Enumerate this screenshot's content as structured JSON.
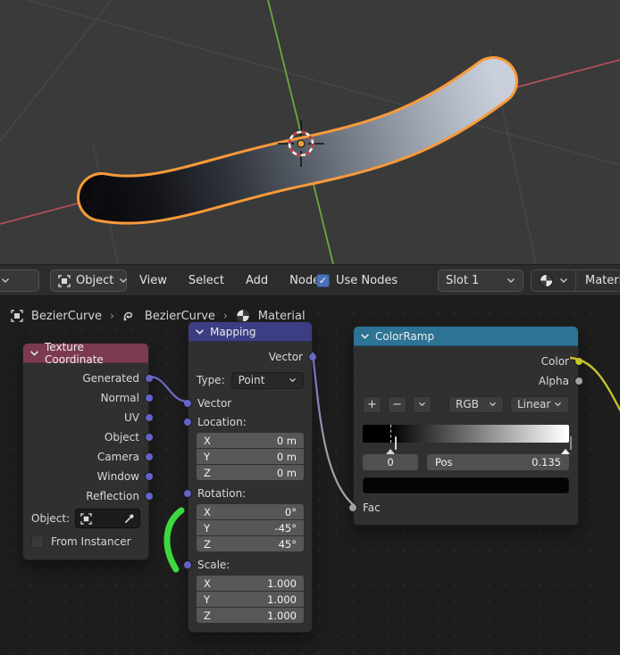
{
  "header": {
    "editor_type_dropdown": {
      "icon": "shader-editor-icon"
    },
    "mode_dropdown": {
      "label": "Object",
      "icon": "object-icon"
    },
    "menus": [
      "View",
      "Select",
      "Add",
      "Node"
    ],
    "use_nodes": {
      "label": "Use Nodes",
      "checked": true,
      "glyph": "✓"
    },
    "slot_dropdown": {
      "label": "Slot 1"
    },
    "material_selector": {
      "icon": "material-sphere-icon"
    },
    "material_field": {
      "label": "Material"
    }
  },
  "breadcrumb": {
    "items": [
      "BezierCurve",
      "BezierCurve",
      "Material"
    ],
    "separator": "›"
  },
  "nodes": {
    "texture_coordinate": {
      "title": "Texture Coordinate",
      "outputs": [
        "Generated",
        "Normal",
        "UV",
        "Object",
        "Camera",
        "Window",
        "Reflection"
      ],
      "object_label": "Object:",
      "from_instancer_label": "From Instancer",
      "from_instancer_checked": false
    },
    "mapping": {
      "title": "Mapping",
      "output": "Vector",
      "type_label": "Type:",
      "type_value": "Point",
      "vector_input": "Vector",
      "axis": {
        "x": "X",
        "y": "Y",
        "z": "Z"
      },
      "location": {
        "label": "Location:",
        "x": "0 m",
        "y": "0 m",
        "z": "0 m"
      },
      "rotation": {
        "label": "Rotation:",
        "x": "0°",
        "y": "-45°",
        "z": "45°"
      },
      "scale": {
        "label": "Scale:",
        "x": "1.000",
        "y": "1.000",
        "z": "1.000"
      }
    },
    "color_ramp": {
      "title": "ColorRamp",
      "outputs": {
        "color": "Color",
        "alpha": "Alpha"
      },
      "add": "+",
      "remove": "−",
      "color_mode": "RGB",
      "interpolation": "Linear",
      "active_index": "0",
      "pos_label": "Pos",
      "pos_value": "0.135",
      "fac_input": "Fac",
      "stops": [
        {
          "pos": "0.135",
          "color": "#000000",
          "active": true
        },
        {
          "pos": "1.000",
          "color": "#ffffff",
          "active": false
        }
      ],
      "active_stop_color": "#000000"
    }
  },
  "viewport": {
    "selected_object": "BezierCurve tube with black-to-white gradient material",
    "overlays": [
      "3d-cursor",
      "x-axis-red",
      "y-axis-green",
      "floor-grid"
    ]
  },
  "colors": {
    "accent": "#f89a3a",
    "axis-x": "#bc4f5e",
    "axis-y": "#68a93f",
    "hdr-tex": "#7c3a50",
    "hdr-map": "#3d3d84",
    "hdr-ramp": "#2d7394",
    "sock-vec": "#6363c7",
    "sock-col": "#c7c729",
    "sock-val": "#a1a1a1",
    "anno": "#3ed83e",
    "chk": "#4a72b8"
  }
}
